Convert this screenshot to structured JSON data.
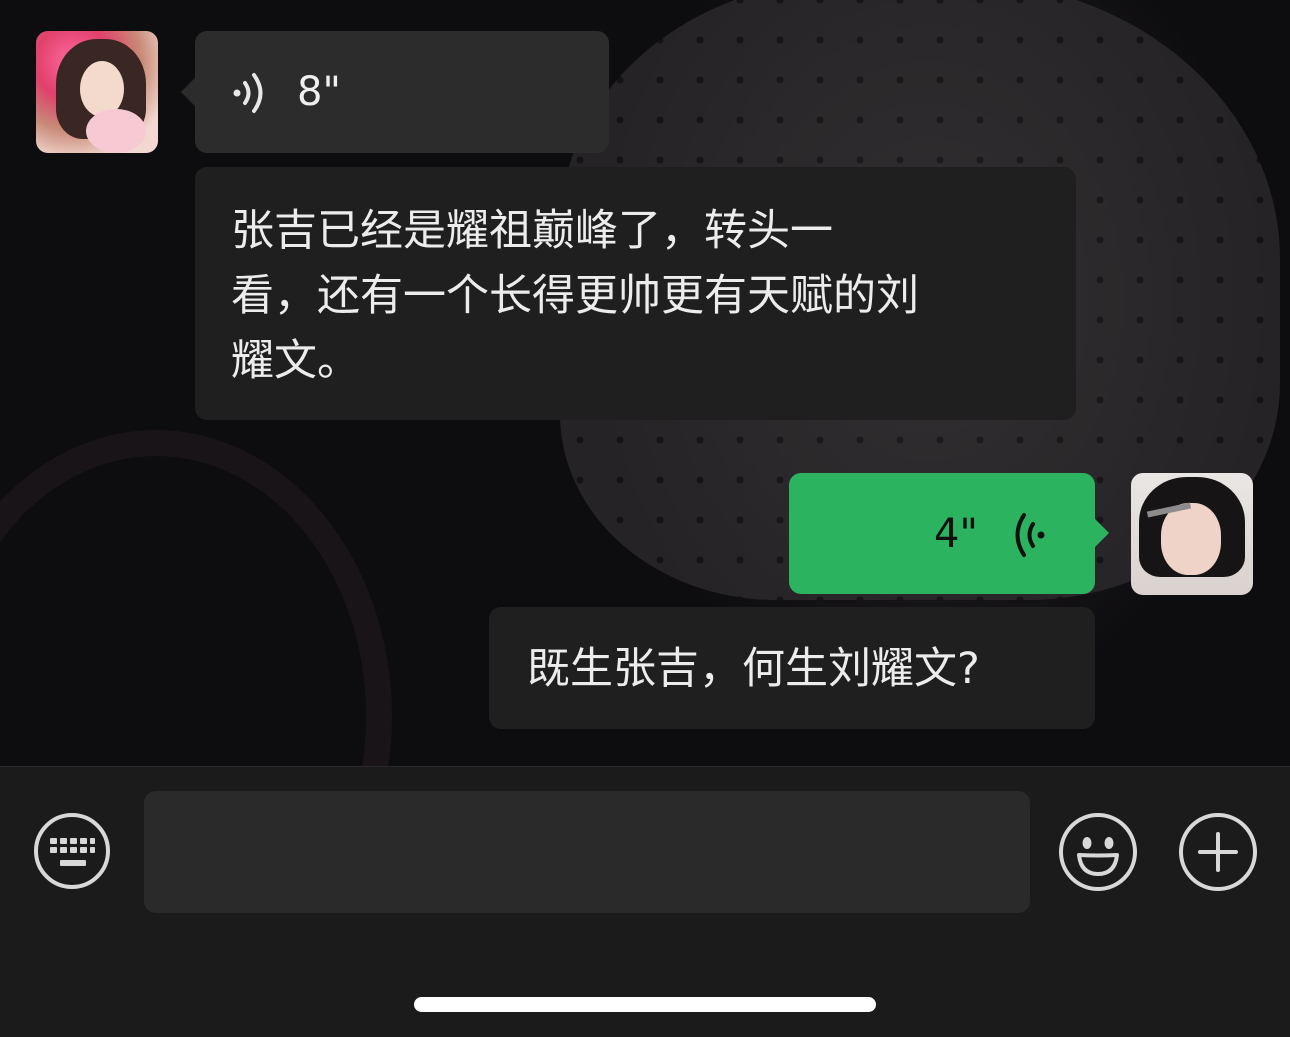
{
  "messages": {
    "incoming_voice": {
      "duration": "8\""
    },
    "incoming_text": {
      "line1": "张吉已经是耀祖巅峰了，转头一",
      "line2": "看，还有一个长得更帅更有天赋的刘",
      "line3": "耀文。"
    },
    "outgoing_voice": {
      "duration": "4\""
    },
    "outgoing_text": {
      "text": "既生张吉，何生刘耀文?"
    }
  },
  "input_bar": {
    "placeholder": ""
  },
  "colors": {
    "outgoing_bubble": "#2bb360",
    "incoming_bubble": "#2c2c2c",
    "text_bubble": "#1f1f1f",
    "input_bg": "#1b1b1b"
  },
  "icons": [
    "voice-wave-icon",
    "keyboard-icon",
    "emoji-icon",
    "plus-icon"
  ]
}
